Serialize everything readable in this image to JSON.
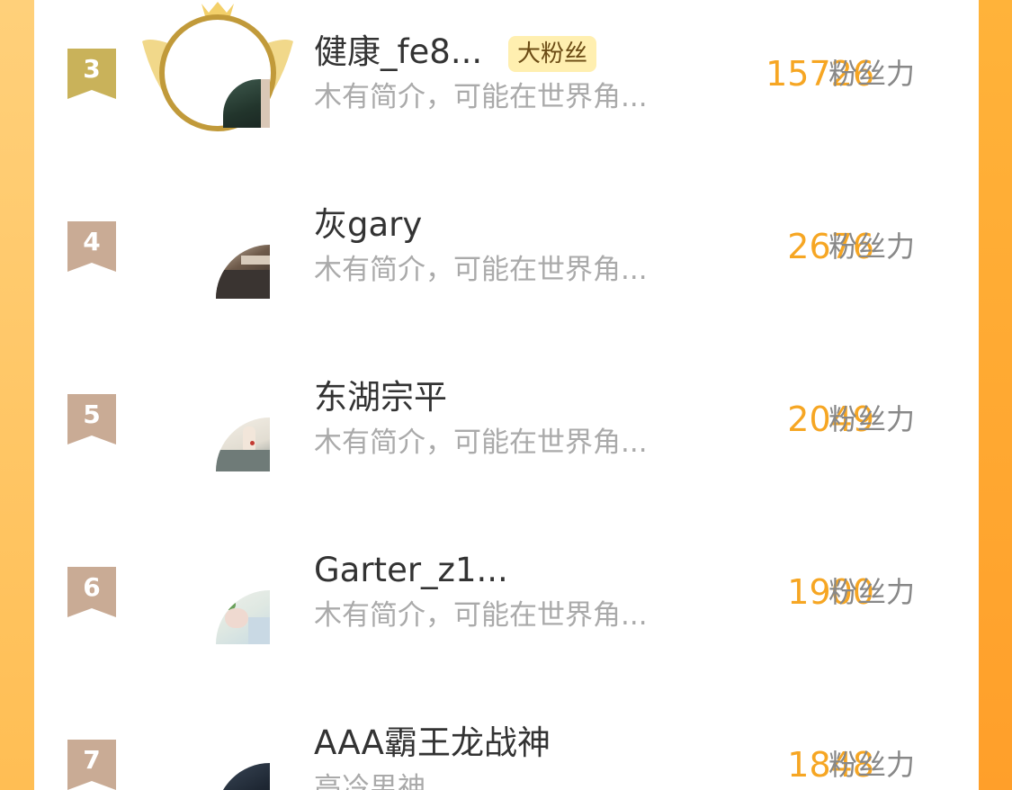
{
  "colors": {
    "score": "#f6a623",
    "rank_gold": "#c9b25a",
    "rank_bronze": "#c9ab95",
    "badge_bg": "#ffefb0",
    "background": "#ffb43e"
  },
  "unit_label": "粉丝力",
  "rows": [
    {
      "rank": "3",
      "name": "健康_fe8...",
      "badge": "大粉丝",
      "bio": "木有简介，可能在世界角...",
      "score": "15726"
    },
    {
      "rank": "4",
      "name": "灰gary",
      "bio": "木有简介，可能在世界角...",
      "score": "2676"
    },
    {
      "rank": "5",
      "name": "东湖宗平",
      "bio": "木有简介，可能在世界角...",
      "score": "2049"
    },
    {
      "rank": "6",
      "name": "Garter_z1...",
      "bio": "木有简介，可能在世界角...",
      "score": "1900"
    },
    {
      "rank": "7",
      "name": "AAA霸王龙战神",
      "bio": "高冷男神",
      "score": "1848"
    }
  ]
}
